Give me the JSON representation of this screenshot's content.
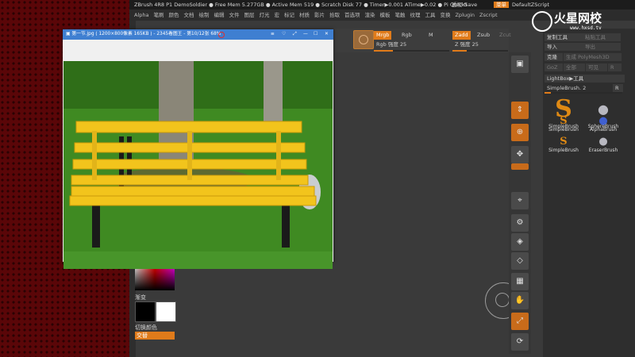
{
  "titlebar": {
    "text": "ZBrush 4R8 P1   DemoSoldier   ● Free Mem 5.277GB ● Active Mem 519 ● Scratch Disk 77 ● Timer▶0.001 ATime▶0.02 ● Pi   QuickSave",
    "transparency": "透视  0",
    "menu_btn": "菜单",
    "script": "DefaultZScript"
  },
  "menubar": [
    "Alpha",
    "笔刷",
    "颜色",
    "文档",
    "绘制",
    "编辑",
    "文件",
    "图层",
    "灯光",
    "宏",
    "标记",
    "材质",
    "影片",
    "拾取",
    "首选项",
    "渲染",
    "模板",
    "笔触",
    "纹理",
    "工具",
    "变换",
    "Zplugin",
    "Zscript"
  ],
  "toolbar": {
    "mrgb": "Mrgb",
    "rgb": "Rgb",
    "m": "M",
    "zadd": "Zadd",
    "zsub": "Zsub",
    "zcut": "Zcut",
    "rgb_intensity": "Rgb 强度 25",
    "z_intensity": "Z 强度 25"
  },
  "tray": {
    "copy_tool": "复制工具",
    "paste_tool": "粘贴工具",
    "import": "导入",
    "export": "导出",
    "clone": "克隆",
    "make_polymesh": "生成 PolyMesh3D",
    "goz": "GoZ",
    "all": "全部",
    "visible": "可见",
    "r": "R",
    "lightbox_tools": "LightBox▶工具",
    "current": "SimpleBrush. 2",
    "r2": "R",
    "brushes": [
      {
        "name": "SimpleBrush",
        "glyph": "S"
      },
      {
        "name": "SphereBrush",
        "glyph": "●"
      },
      {
        "name": "SimpleBrush",
        "glyph": "S"
      },
      {
        "name": "AlphaBrush",
        "glyph": "●"
      },
      {
        "name": "SimpleBrush",
        "glyph": "S"
      },
      {
        "name": "EraserBrush",
        "glyph": "●"
      }
    ]
  },
  "colorpanel": {
    "gradient": "渐变",
    "switch": "切换颜色",
    "alternate": "交替"
  },
  "viewer": {
    "title": "第一节.jpg ( 1200×800像素  165KB ) - 2345看图王 - 第10/12张 68%"
  },
  "watermark": {
    "brand": "火星网校",
    "url": "www.hxsd.tv"
  },
  "colors": {
    "accent": "#e07b1a",
    "bench": "#f2c41c",
    "grass": "#3f8a22"
  }
}
